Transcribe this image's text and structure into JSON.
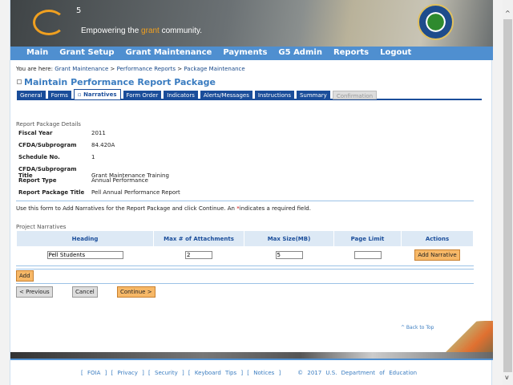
{
  "header": {
    "logo_sup": "5",
    "tagline_pre": "Empowering the ",
    "tagline_accent": "grant",
    "tagline_post": " community."
  },
  "nav": [
    "Main",
    "Grant Setup",
    "Grant Maintenance",
    "Payments",
    "G5 Admin",
    "Reports",
    "Logout"
  ],
  "breadcrumb": {
    "prefix": "You are here:",
    "items": [
      "Grant Maintenance",
      "Performance Reports",
      "Package Maintenance"
    ],
    "sep": " > "
  },
  "page_title": "Maintain Performance Report Package",
  "tabs": [
    {
      "label": "General"
    },
    {
      "label": "Forms"
    },
    {
      "label": "Narratives",
      "active": true
    },
    {
      "label": "Form Order"
    },
    {
      "label": "Indicators"
    },
    {
      "label": "Alerts/Messages"
    },
    {
      "label": "Instructions"
    },
    {
      "label": "Summary"
    },
    {
      "label": "Confirmation",
      "disabled": true
    }
  ],
  "details": {
    "section_label": "Report Package Details",
    "rows": [
      {
        "label": "Fiscal Year",
        "value": "2011"
      },
      {
        "label": "CFDA/Subprogram",
        "value": "84.420A"
      },
      {
        "label": "Schedule No.",
        "value": "1"
      },
      {
        "label": "CFDA/Subprogram Title",
        "value": "Grant Maintenance Training"
      },
      {
        "label": "Report Type",
        "value": "Annual Performance"
      },
      {
        "label": "Report Package Title",
        "value": "Pell Annual Performance Report"
      }
    ]
  },
  "instructions": {
    "text": "Use this form to Add Narratives for the Report Package and click Continue.  An ",
    "star": "*",
    "rest": "indicates a required field."
  },
  "narratives": {
    "section_label": "Project Narratives",
    "columns": [
      "Heading",
      "Max # of Attachments",
      "Max Size(MB)",
      "Page Limit",
      "Actions"
    ],
    "row": {
      "heading": "Pell Students",
      "max_attachments": "2",
      "max_size": "5",
      "page_limit": "",
      "action": "Add Narrative"
    }
  },
  "buttons": {
    "add": "Add",
    "previous": "< Previous",
    "cancel": "Cancel",
    "continue": "Continue >"
  },
  "back_to_top": "^ Back to Top",
  "footer": {
    "links": [
      "FOIA",
      "Privacy",
      "Security",
      "Keyboard Tips",
      "Notices"
    ],
    "copyright": "© 2017 U.S. Department of Education"
  },
  "colors": {
    "nav": "#4f8fd0",
    "tab": "#1a4d9a",
    "accent": "#f0a020",
    "button": "#f7b867"
  }
}
